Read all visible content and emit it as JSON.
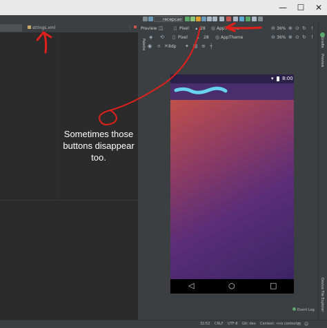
{
  "window": {
    "minimize": "—",
    "maximize": "☐",
    "close": "✕"
  },
  "toolbar": {
    "run_config": "recepcao"
  },
  "editor": {
    "tabs": [
      {
        "label": "strings.xml"
      }
    ]
  },
  "palette_label": "Palette",
  "preview": {
    "label": "Preview",
    "row1": {
      "device": "Pixel",
      "api": "28",
      "theme": "AppTheme",
      "zoom": "36%"
    },
    "row2": {
      "device": "Pixel",
      "api": "28",
      "theme": "AppTheme",
      "zoom": "36%"
    },
    "row3": {
      "margin": "8dp"
    },
    "phone": {
      "time": "8:00",
      "nav_back": "◁",
      "nav_home": "○",
      "nav_recents": "□"
    }
  },
  "right_strip": {
    "gradle": "Gradle",
    "preview": "Preview",
    "device_file_explorer": "Device File Explorer"
  },
  "annotation": {
    "text": "Sometimes those buttons disappear too."
  },
  "statusbar": {
    "position": "32:52",
    "line_separator": "CRLF",
    "encoding": "UTF-8",
    "git": "Git: dev",
    "context": "Context: <no context>",
    "event_log": "Event Log"
  },
  "colors": {
    "annotation": "#e0201a",
    "run": "#59a869",
    "stop": "#c75450"
  }
}
